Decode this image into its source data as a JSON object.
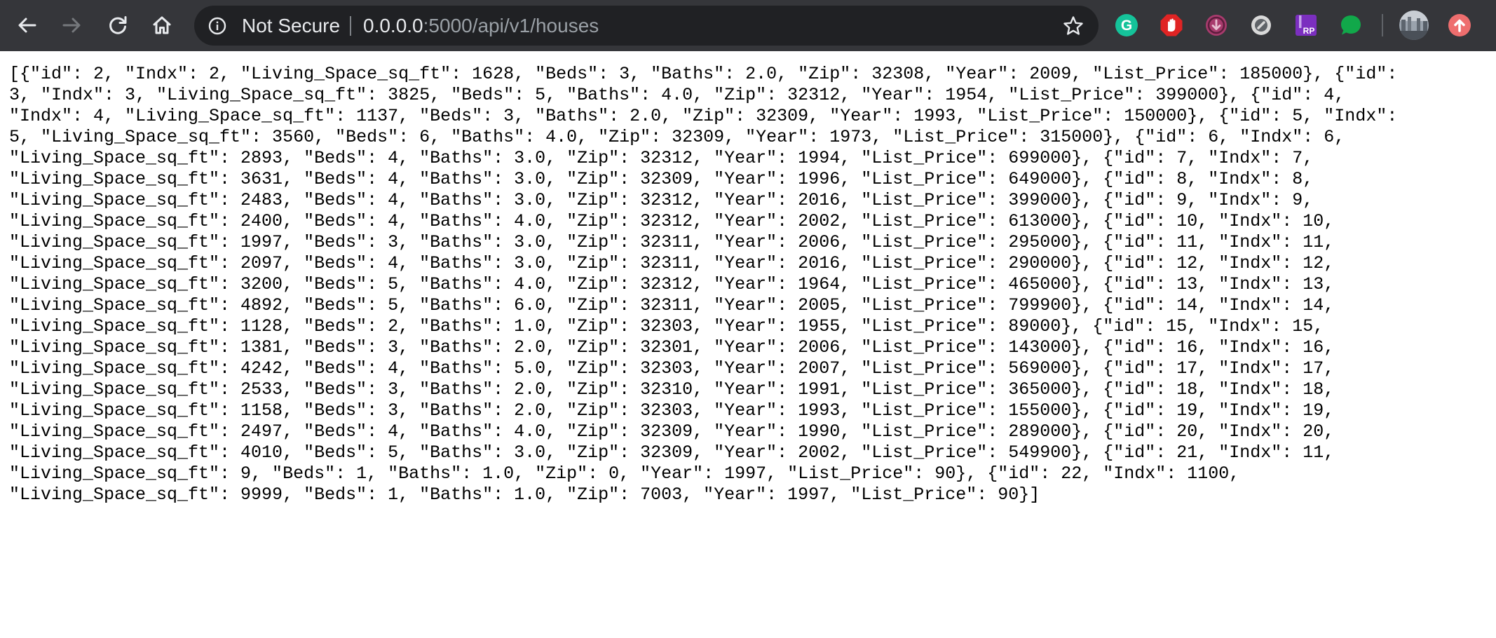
{
  "browser": {
    "security_label": "Not Secure",
    "url_host": "0.0.0.0",
    "url_path": ":5000/api/v1/houses",
    "toolbar_icons": [
      "back-icon",
      "forward-icon",
      "reload-icon",
      "home-icon",
      "info-icon",
      "bookmark-star-icon"
    ],
    "extensions": [
      {
        "name": "grammarly-extension-icon",
        "letter": "G",
        "color": "#15c39a"
      },
      {
        "name": "adblock-extension-icon",
        "color": "#e02424"
      },
      {
        "name": "download-extension-icon",
        "color": "#a83b6d"
      },
      {
        "name": "circle-extension-icon",
        "color": "#d9d9d9"
      },
      {
        "name": "rp-extension-icon",
        "letter": "RP",
        "color": "#7b2fbf"
      },
      {
        "name": "green-chat-extension-icon",
        "color": "#11a84a"
      },
      {
        "name": "profile-avatar-icon",
        "color": "#8a8f96"
      },
      {
        "name": "update-icon",
        "color": "#ee6e6e"
      }
    ],
    "colors": {
      "toolbar": "#35363a",
      "omnibox": "#202124"
    }
  },
  "page": {
    "json_lines": [
      "[{\"id\": 2, \"Indx\": 2, \"Living_Space_sq_ft\": 1628, \"Beds\": 3, \"Baths\": 2.0, \"Zip\": 32308, \"Year\": 2009, \"List_Price\": 185000}, {\"id\":",
      "3, \"Indx\": 3, \"Living_Space_sq_ft\": 3825, \"Beds\": 5, \"Baths\": 4.0, \"Zip\": 32312, \"Year\": 1954, \"List_Price\": 399000}, {\"id\": 4,",
      "\"Indx\": 4, \"Living_Space_sq_ft\": 1137, \"Beds\": 3, \"Baths\": 2.0, \"Zip\": 32309, \"Year\": 1993, \"List_Price\": 150000}, {\"id\": 5, \"Indx\":",
      "5, \"Living_Space_sq_ft\": 3560, \"Beds\": 6, \"Baths\": 4.0, \"Zip\": 32309, \"Year\": 1973, \"List_Price\": 315000}, {\"id\": 6, \"Indx\": 6,",
      "\"Living_Space_sq_ft\": 2893, \"Beds\": 4, \"Baths\": 3.0, \"Zip\": 32312, \"Year\": 1994, \"List_Price\": 699000}, {\"id\": 7, \"Indx\": 7,",
      "\"Living_Space_sq_ft\": 3631, \"Beds\": 4, \"Baths\": 3.0, \"Zip\": 32309, \"Year\": 1996, \"List_Price\": 649000}, {\"id\": 8, \"Indx\": 8,",
      "\"Living_Space_sq_ft\": 2483, \"Beds\": 4, \"Baths\": 3.0, \"Zip\": 32312, \"Year\": 2016, \"List_Price\": 399000}, {\"id\": 9, \"Indx\": 9,",
      "\"Living_Space_sq_ft\": 2400, \"Beds\": 4, \"Baths\": 4.0, \"Zip\": 32312, \"Year\": 2002, \"List_Price\": 613000}, {\"id\": 10, \"Indx\": 10,",
      "\"Living_Space_sq_ft\": 1997, \"Beds\": 3, \"Baths\": 3.0, \"Zip\": 32311, \"Year\": 2006, \"List_Price\": 295000}, {\"id\": 11, \"Indx\": 11,",
      "\"Living_Space_sq_ft\": 2097, \"Beds\": 4, \"Baths\": 3.0, \"Zip\": 32311, \"Year\": 2016, \"List_Price\": 290000}, {\"id\": 12, \"Indx\": 12,",
      "\"Living_Space_sq_ft\": 3200, \"Beds\": 5, \"Baths\": 4.0, \"Zip\": 32312, \"Year\": 1964, \"List_Price\": 465000}, {\"id\": 13, \"Indx\": 13,",
      "\"Living_Space_sq_ft\": 4892, \"Beds\": 5, \"Baths\": 6.0, \"Zip\": 32311, \"Year\": 2005, \"List_Price\": 799900}, {\"id\": 14, \"Indx\": 14,",
      "\"Living_Space_sq_ft\": 1128, \"Beds\": 2, \"Baths\": 1.0, \"Zip\": 32303, \"Year\": 1955, \"List_Price\": 89000}, {\"id\": 15, \"Indx\": 15,",
      "\"Living_Space_sq_ft\": 1381, \"Beds\": 3, \"Baths\": 2.0, \"Zip\": 32301, \"Year\": 2006, \"List_Price\": 143000}, {\"id\": 16, \"Indx\": 16,",
      "\"Living_Space_sq_ft\": 4242, \"Beds\": 4, \"Baths\": 5.0, \"Zip\": 32303, \"Year\": 2007, \"List_Price\": 569000}, {\"id\": 17, \"Indx\": 17,",
      "\"Living_Space_sq_ft\": 2533, \"Beds\": 3, \"Baths\": 2.0, \"Zip\": 32310, \"Year\": 1991, \"List_Price\": 365000}, {\"id\": 18, \"Indx\": 18,",
      "\"Living_Space_sq_ft\": 1158, \"Beds\": 3, \"Baths\": 2.0, \"Zip\": 32303, \"Year\": 1993, \"List_Price\": 155000}, {\"id\": 19, \"Indx\": 19,",
      "\"Living_Space_sq_ft\": 2497, \"Beds\": 4, \"Baths\": 4.0, \"Zip\": 32309, \"Year\": 1990, \"List_Price\": 289000}, {\"id\": 20, \"Indx\": 20,",
      "\"Living_Space_sq_ft\": 4010, \"Beds\": 5, \"Baths\": 3.0, \"Zip\": 32309, \"Year\": 2002, \"List_Price\": 549900}, {\"id\": 21, \"Indx\": 11,",
      "\"Living_Space_sq_ft\": 9, \"Beds\": 1, \"Baths\": 1.0, \"Zip\": 0, \"Year\": 1997, \"List_Price\": 90}, {\"id\": 22, \"Indx\": 1100,",
      "\"Living_Space_sq_ft\": 9999, \"Beds\": 1, \"Baths\": 1.0, \"Zip\": 7003, \"Year\": 1997, \"List_Price\": 90}]"
    ]
  }
}
